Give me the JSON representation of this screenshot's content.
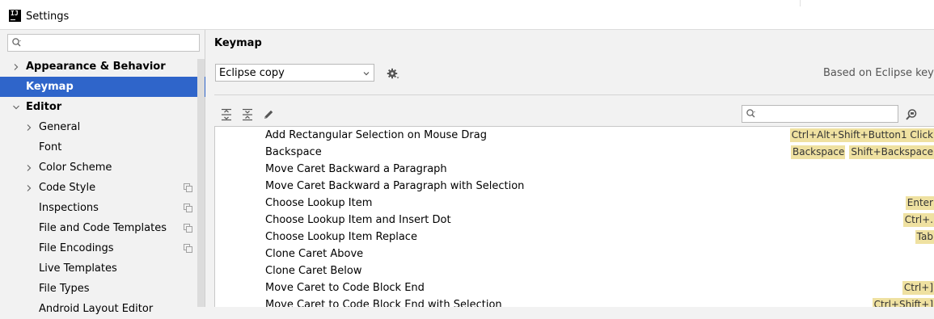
{
  "window": {
    "title": "Settings",
    "app_icon_text": "IJ"
  },
  "sidebar": {
    "search": {
      "value": "",
      "placeholder": ""
    },
    "items": [
      {
        "label": "Appearance & Behavior",
        "level": 0,
        "expandable": true,
        "expanded": false,
        "bold": true,
        "selected": false
      },
      {
        "label": "Keymap",
        "level": 0,
        "expandable": false,
        "bold": true,
        "selected": true
      },
      {
        "label": "Editor",
        "level": 0,
        "expandable": true,
        "expanded": true,
        "bold": true,
        "selected": false
      },
      {
        "label": "General",
        "level": 1,
        "expandable": true,
        "expanded": false,
        "selected": false
      },
      {
        "label": "Font",
        "level": 1,
        "expandable": false,
        "selected": false
      },
      {
        "label": "Color Scheme",
        "level": 1,
        "expandable": true,
        "expanded": false,
        "selected": false
      },
      {
        "label": "Code Style",
        "level": 1,
        "expandable": true,
        "expanded": false,
        "project_icon": true,
        "selected": false
      },
      {
        "label": "Inspections",
        "level": 1,
        "expandable": false,
        "project_icon": true,
        "selected": false
      },
      {
        "label": "File and Code Templates",
        "level": 1,
        "expandable": false,
        "project_icon": true,
        "selected": false
      },
      {
        "label": "File Encodings",
        "level": 1,
        "expandable": false,
        "project_icon": true,
        "selected": false
      },
      {
        "label": "Live Templates",
        "level": 1,
        "expandable": false,
        "selected": false
      },
      {
        "label": "File Types",
        "level": 1,
        "expandable": false,
        "selected": false
      },
      {
        "label": "Android Layout Editor",
        "level": 1,
        "expandable": false,
        "selected": false
      }
    ]
  },
  "main": {
    "title": "Keymap",
    "keymap_select": {
      "value": "Eclipse copy"
    },
    "based_on": "Based on Eclipse keyma",
    "filter": {
      "value": "",
      "placeholder": ""
    },
    "actions": [
      {
        "name": "Add Rectangular Selection on Mouse Drag",
        "shortcuts": [
          "Ctrl+Alt+Shift+Button1 Click"
        ]
      },
      {
        "name": "Backspace",
        "shortcuts": [
          "Backspace",
          "Shift+Backspace"
        ]
      },
      {
        "name": "Move Caret Backward a Paragraph",
        "shortcuts": []
      },
      {
        "name": "Move Caret Backward a Paragraph with Selection",
        "shortcuts": []
      },
      {
        "name": "Choose Lookup Item",
        "shortcuts": [
          "Enter"
        ]
      },
      {
        "name": "Choose Lookup Item and Insert Dot",
        "shortcuts": [
          "Ctrl+."
        ]
      },
      {
        "name": "Choose Lookup Item Replace",
        "shortcuts": [
          "Tab"
        ]
      },
      {
        "name": "Clone Caret Above",
        "shortcuts": []
      },
      {
        "name": "Clone Caret Below",
        "shortcuts": []
      },
      {
        "name": "Move Caret to Code Block End",
        "shortcuts": [
          "Ctrl+]"
        ]
      },
      {
        "name": "Move Caret to Code Block End with Selection",
        "shortcuts": [
          "Ctrl+Shift+]"
        ]
      }
    ]
  },
  "colors": {
    "selection": "#2f65ca",
    "shortcut_badge": "#efe1a1",
    "panel_bg": "#f2f2f2",
    "table_bg": "#ffffff"
  },
  "icons": {
    "title": "intellij-idea-icon",
    "search": "search-icon",
    "expand": "chevron-right-icon",
    "collapse": "chevron-down-icon",
    "project": "project-copy-icon",
    "gear": "gear-icon",
    "expand_all": "expand-all-icon",
    "collapse_all": "collapse-all-icon",
    "edit": "pencil-icon",
    "find_shortcut": "find-by-shortcut-icon"
  }
}
